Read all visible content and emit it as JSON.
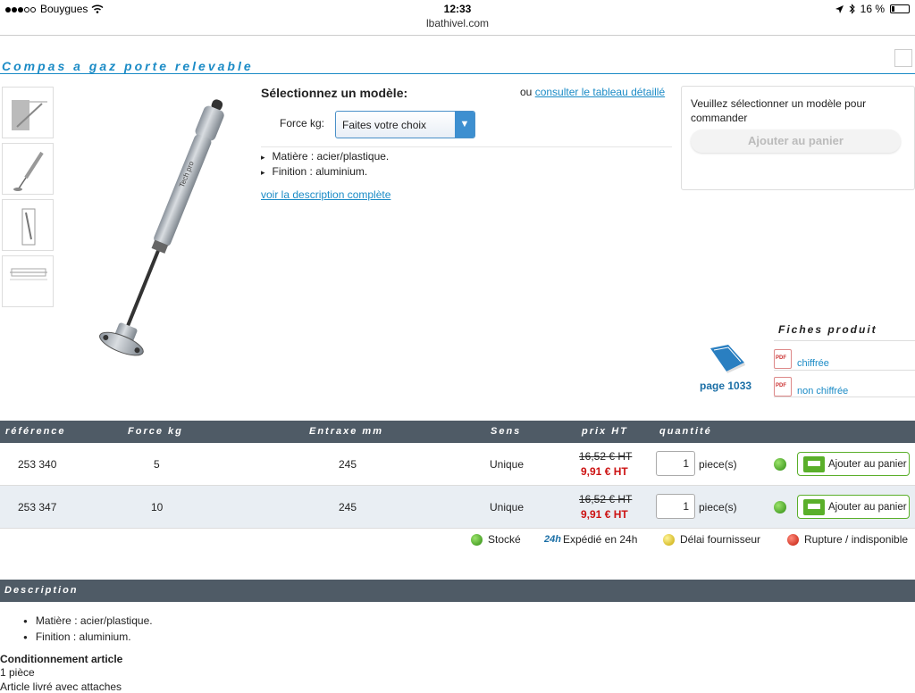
{
  "status_bar": {
    "carrier": "Bouygues",
    "time": "12:33",
    "battery_percent": "16 %",
    "battery_level": 0.16,
    "url": "lbathivel.com"
  },
  "page": {
    "title": "Compas a gaz porte relevable"
  },
  "model_select": {
    "heading": "Sélectionnez un modèle:",
    "consult_prefix": "ou",
    "consult_link": "consulter le tableau détaillé",
    "force_label": "Force kg:",
    "force_value": "Faites votre choix",
    "features": [
      "Matière : acier/plastique.",
      "Finition : aluminium."
    ],
    "description_link": "voir la description complète"
  },
  "order_panel": {
    "message": "Veuillez sélectionner un modèle pour commander",
    "add_button": "Ajouter au panier"
  },
  "catalog": {
    "page_label": "page 1033"
  },
  "fiches": {
    "title": "Fiches produit",
    "links": [
      "chiffrée",
      "non chiffrée"
    ]
  },
  "table": {
    "headers": {
      "reference": "référence",
      "force": "Force kg",
      "entraxe": "Entraxe mm",
      "sens": "Sens",
      "prix": "prix HT",
      "quantite": "quantité"
    },
    "rows": [
      {
        "reference": "253 340",
        "force": "5",
        "entraxe": "245",
        "sens": "Unique",
        "old_price": "16,52 € HT",
        "new_price": "9,91 € HT",
        "qty": "1",
        "unit": "piece(s)",
        "button": "Ajouter au panier"
      },
      {
        "reference": "253 347",
        "force": "10",
        "entraxe": "245",
        "sens": "Unique",
        "old_price": "16,52 € HT",
        "new_price": "9,91 € HT",
        "qty": "1",
        "unit": "piece(s)",
        "button": "Ajouter au panier"
      }
    ]
  },
  "legend": {
    "stocked": "Stocké",
    "h24_badge": "24h",
    "shipped": "Expédié en 24h",
    "delay": "Délai fournisseur",
    "rupture": "Rupture / indisponible"
  },
  "description": {
    "header": "Description",
    "items": [
      "Matière : acier/plastique.",
      "Finition : aluminium."
    ],
    "cond_title": "Conditionnement article",
    "cond_lines": [
      "1 pièce",
      "Article livré avec attaches"
    ]
  },
  "colors": {
    "accent": "#1b8bc6",
    "header_bar": "#4f5b66",
    "price_red": "#cc1111",
    "button_green": "#5aaf2a"
  }
}
